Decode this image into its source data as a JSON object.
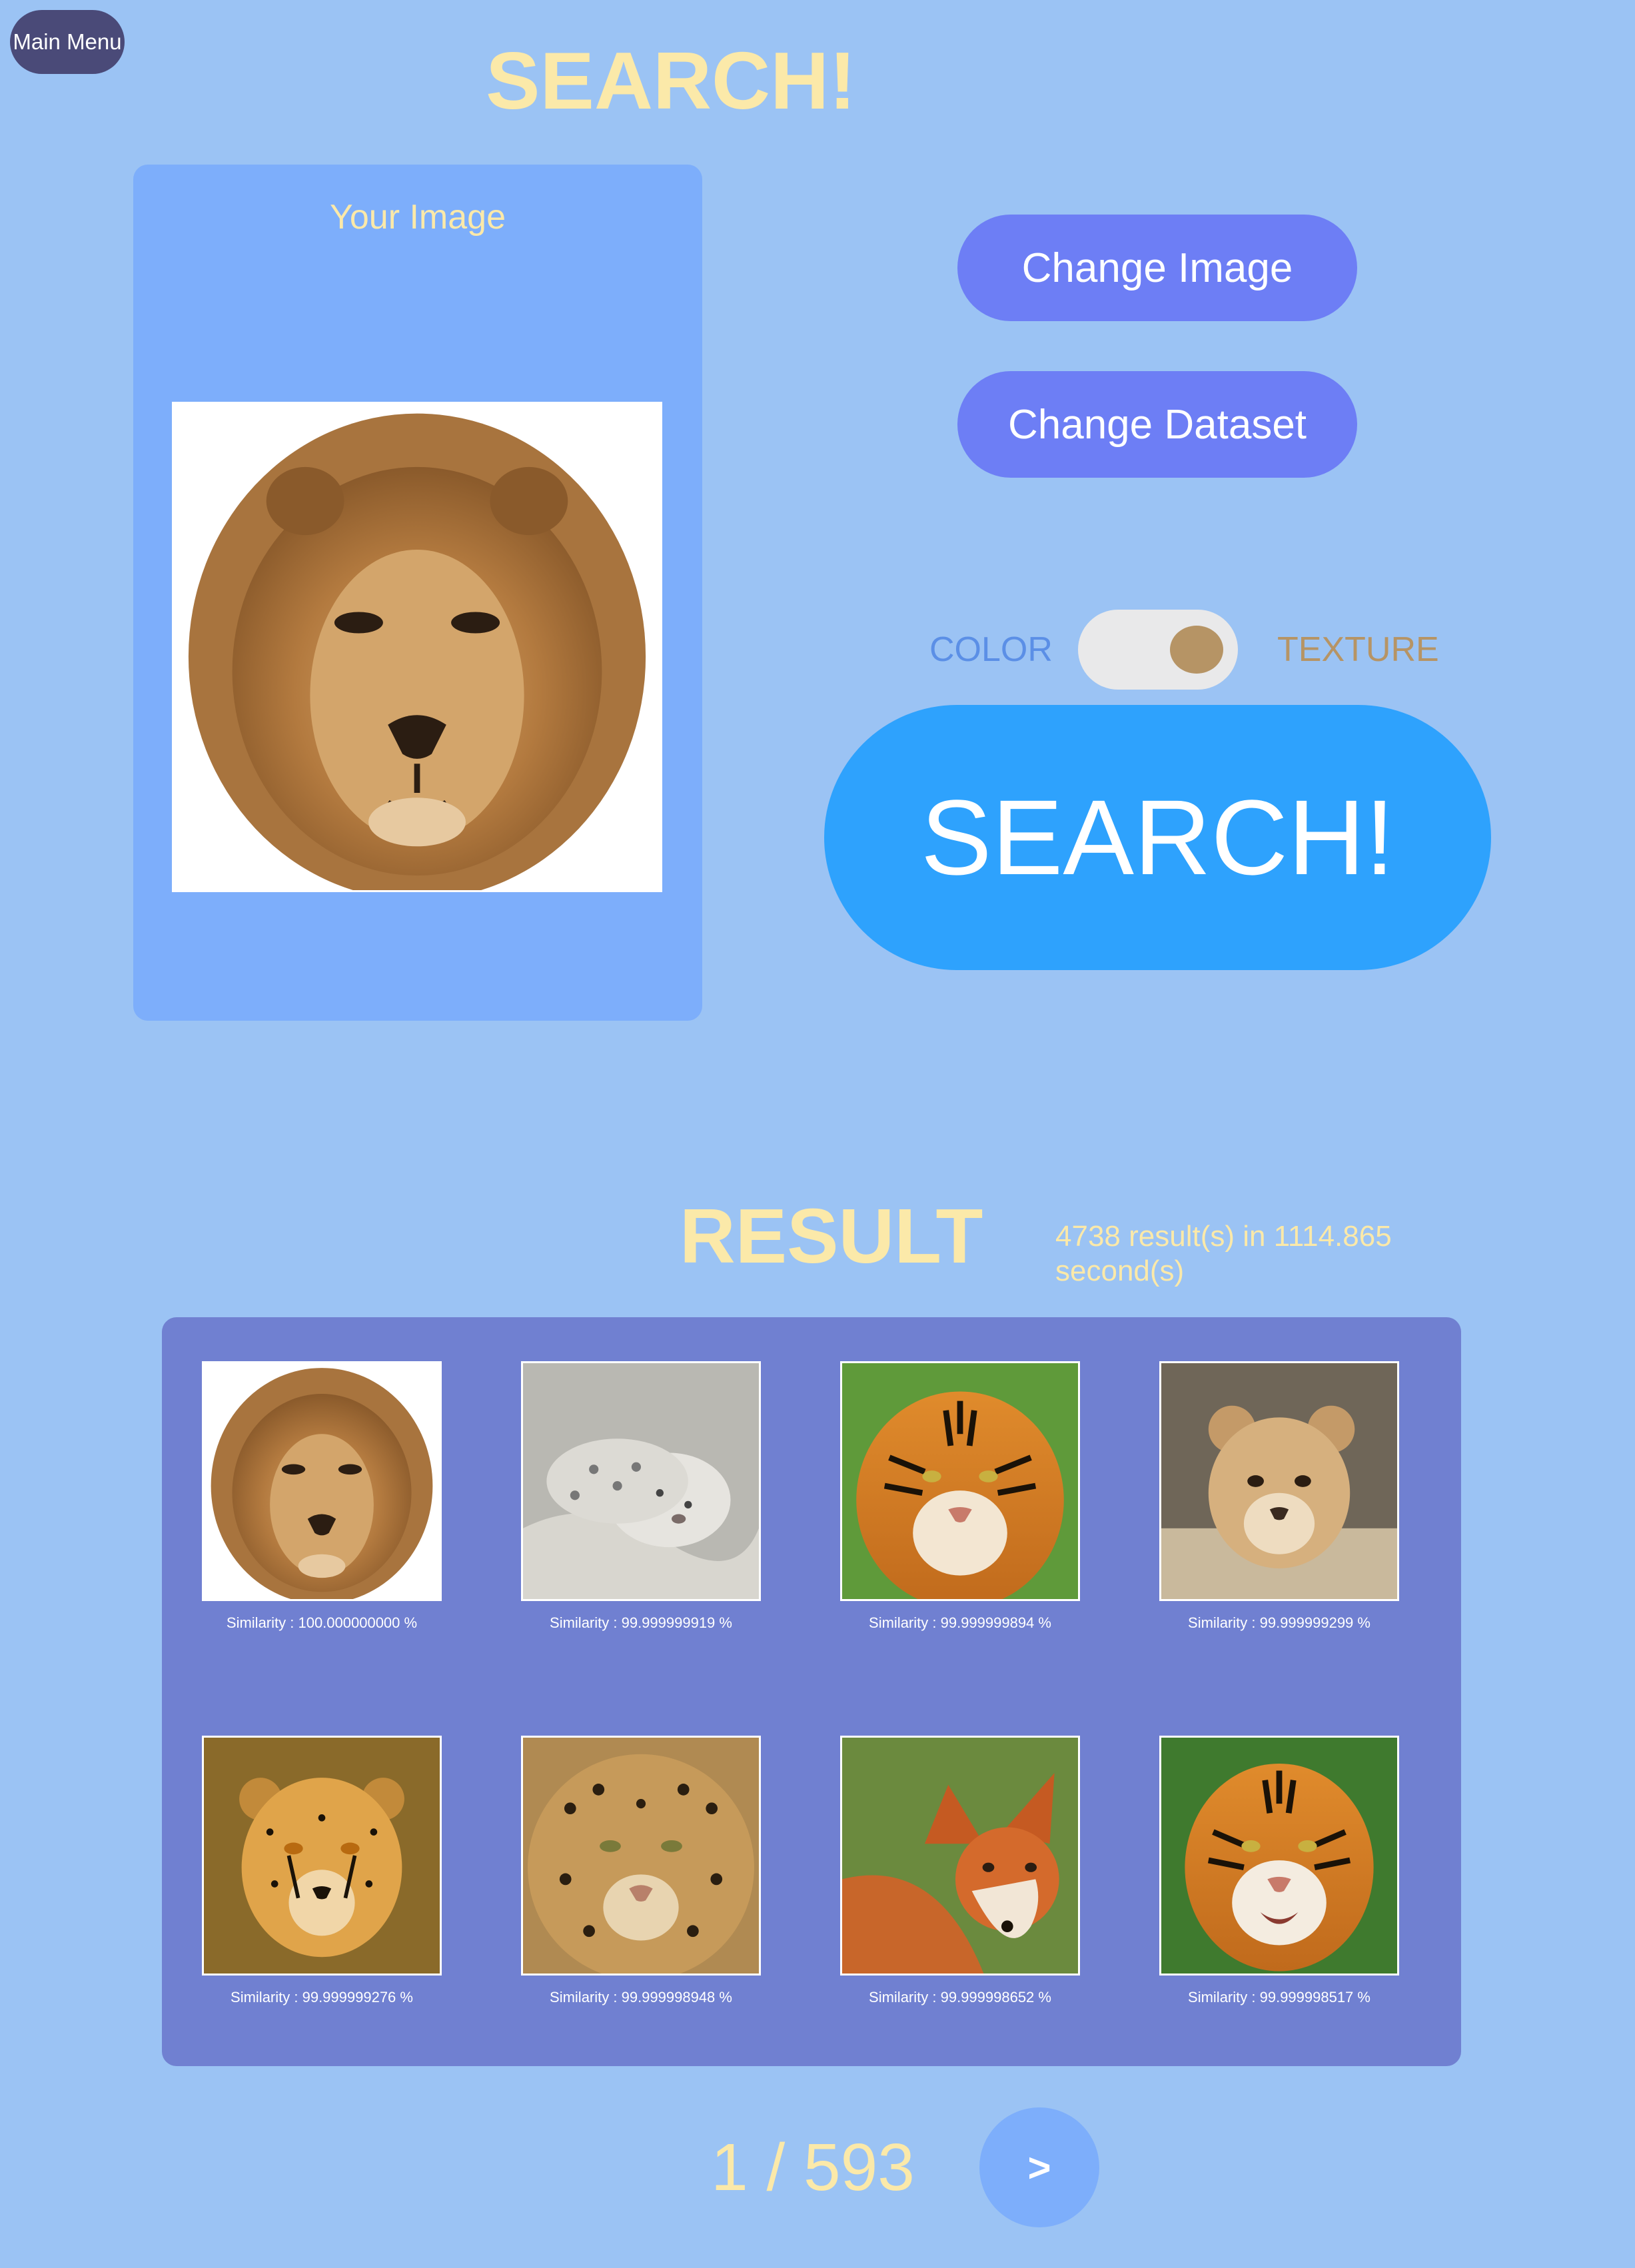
{
  "header": {
    "main_menu_label": "Main Menu",
    "title": "SEARCH!"
  },
  "query": {
    "label": "Your Image",
    "image": "lion-face"
  },
  "controls": {
    "change_image_label": "Change Image",
    "change_dataset_label": "Change Dataset",
    "toggle": {
      "left_label": "COLOR",
      "right_label": "TEXTURE",
      "selected": "TEXTURE",
      "left_color": "#5b8fe6",
      "right_color": "#b69465"
    },
    "search_label": "SEARCH!"
  },
  "results": {
    "title": "RESULT",
    "stats": "4738 result(s) in 1114.865 second(s)",
    "items": [
      {
        "image": "lion",
        "caption": "Similarity : 100.000000000 %"
      },
      {
        "image": "snow-leopard",
        "caption": "Similarity : 99.999999919 %"
      },
      {
        "image": "tiger",
        "caption": "Similarity : 99.999999894 %"
      },
      {
        "image": "lion-cub",
        "caption": "Similarity : 99.999999299 %"
      },
      {
        "image": "cheetah",
        "caption": "Similarity : 99.999999276 %"
      },
      {
        "image": "leopard",
        "caption": "Similarity : 99.999998948 %"
      },
      {
        "image": "red-fox",
        "caption": "Similarity : 99.999998652 %"
      },
      {
        "image": "tiger",
        "caption": "Similarity : 99.999998517 %"
      }
    ]
  },
  "pagination": {
    "indicator": "1 / 593",
    "next_label": ">"
  },
  "colors": {
    "background": "#9bc3f4",
    "title": "#fbe9a9",
    "panel": "#7daefb",
    "results_panel": "#7080d1",
    "button": "#6d7ef5",
    "search_button": "#2ea2fd",
    "main_menu": "#4a4a78"
  }
}
